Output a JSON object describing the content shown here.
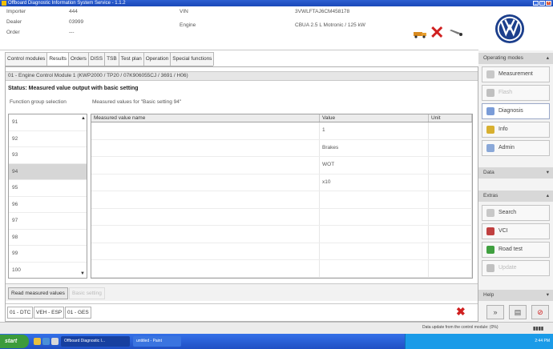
{
  "window": {
    "title": "Offboard Diagnostic Information System Service - 1.1.2"
  },
  "header": {
    "importer_label": "Importer",
    "importer_value": "444",
    "dealer_label": "Dealer",
    "dealer_value": "03999",
    "order_label": "Order",
    "order_value": "---",
    "vin_label": "VIN",
    "vin_value": "3VWLFTAJ6CM458178",
    "engine_label": "Engine",
    "engine_value": "CBUA 2.5 L Motronic / 125 kW"
  },
  "tabs": [
    {
      "label": "Control modules"
    },
    {
      "label": "Results"
    },
    {
      "label": "Orders"
    },
    {
      "label": "DISS"
    },
    {
      "label": "TSB"
    },
    {
      "label": "Test plan"
    },
    {
      "label": "Operation"
    },
    {
      "label": "Special functions"
    }
  ],
  "main": {
    "path": "01 - Engine Control Module 1  (KWP2000 / TP20 / 07K906055CJ  / 3691 / H06)",
    "status": "Status: Measured value output with basic setting",
    "fg_label": "Function group selection",
    "mv_label": "Measured values for \"Basic setting 94\"",
    "fg_items": [
      "91",
      "92",
      "93",
      "94",
      "95",
      "96",
      "97",
      "98",
      "99",
      "100"
    ],
    "table_headers": {
      "name": "Measured value name",
      "value": "Value",
      "unit": "Unit"
    },
    "table_rows": [
      {
        "name": "",
        "value": "1",
        "unit": ""
      },
      {
        "name": "",
        "value": "Brakes",
        "unit": ""
      },
      {
        "name": "",
        "value": "WOT",
        "unit": ""
      },
      {
        "name": "",
        "value": "x10",
        "unit": ""
      },
      {
        "name": "",
        "value": "",
        "unit": ""
      },
      {
        "name": "",
        "value": "",
        "unit": ""
      },
      {
        "name": "",
        "value": "",
        "unit": ""
      },
      {
        "name": "",
        "value": "",
        "unit": ""
      },
      {
        "name": "",
        "value": "",
        "unit": ""
      }
    ],
    "read_btn": "Read measured values",
    "basic_btn": "Basic setting",
    "crumbs": [
      "01 - DTC",
      "VEH - ESP",
      "01 - GES"
    ]
  },
  "right": {
    "operating_modes": "Operating modes",
    "measurement": "Measurement",
    "flash": "Flash",
    "diagnosis": "Diagnosis",
    "info": "Info",
    "admin": "Admin",
    "data": "Data",
    "extras": "Extras",
    "search": "Search",
    "vci": "VCI",
    "road_test": "Road test",
    "update": "Update",
    "help": "Help"
  },
  "statusbar": {
    "message": "Data update from the control module: (0%)",
    "bars": "▮▮▮▮"
  },
  "taskbar": {
    "start": "start",
    "task1": "Offboard Diagnostic I...",
    "task2": "untitled - Paint",
    "time": "2:44 PM"
  }
}
